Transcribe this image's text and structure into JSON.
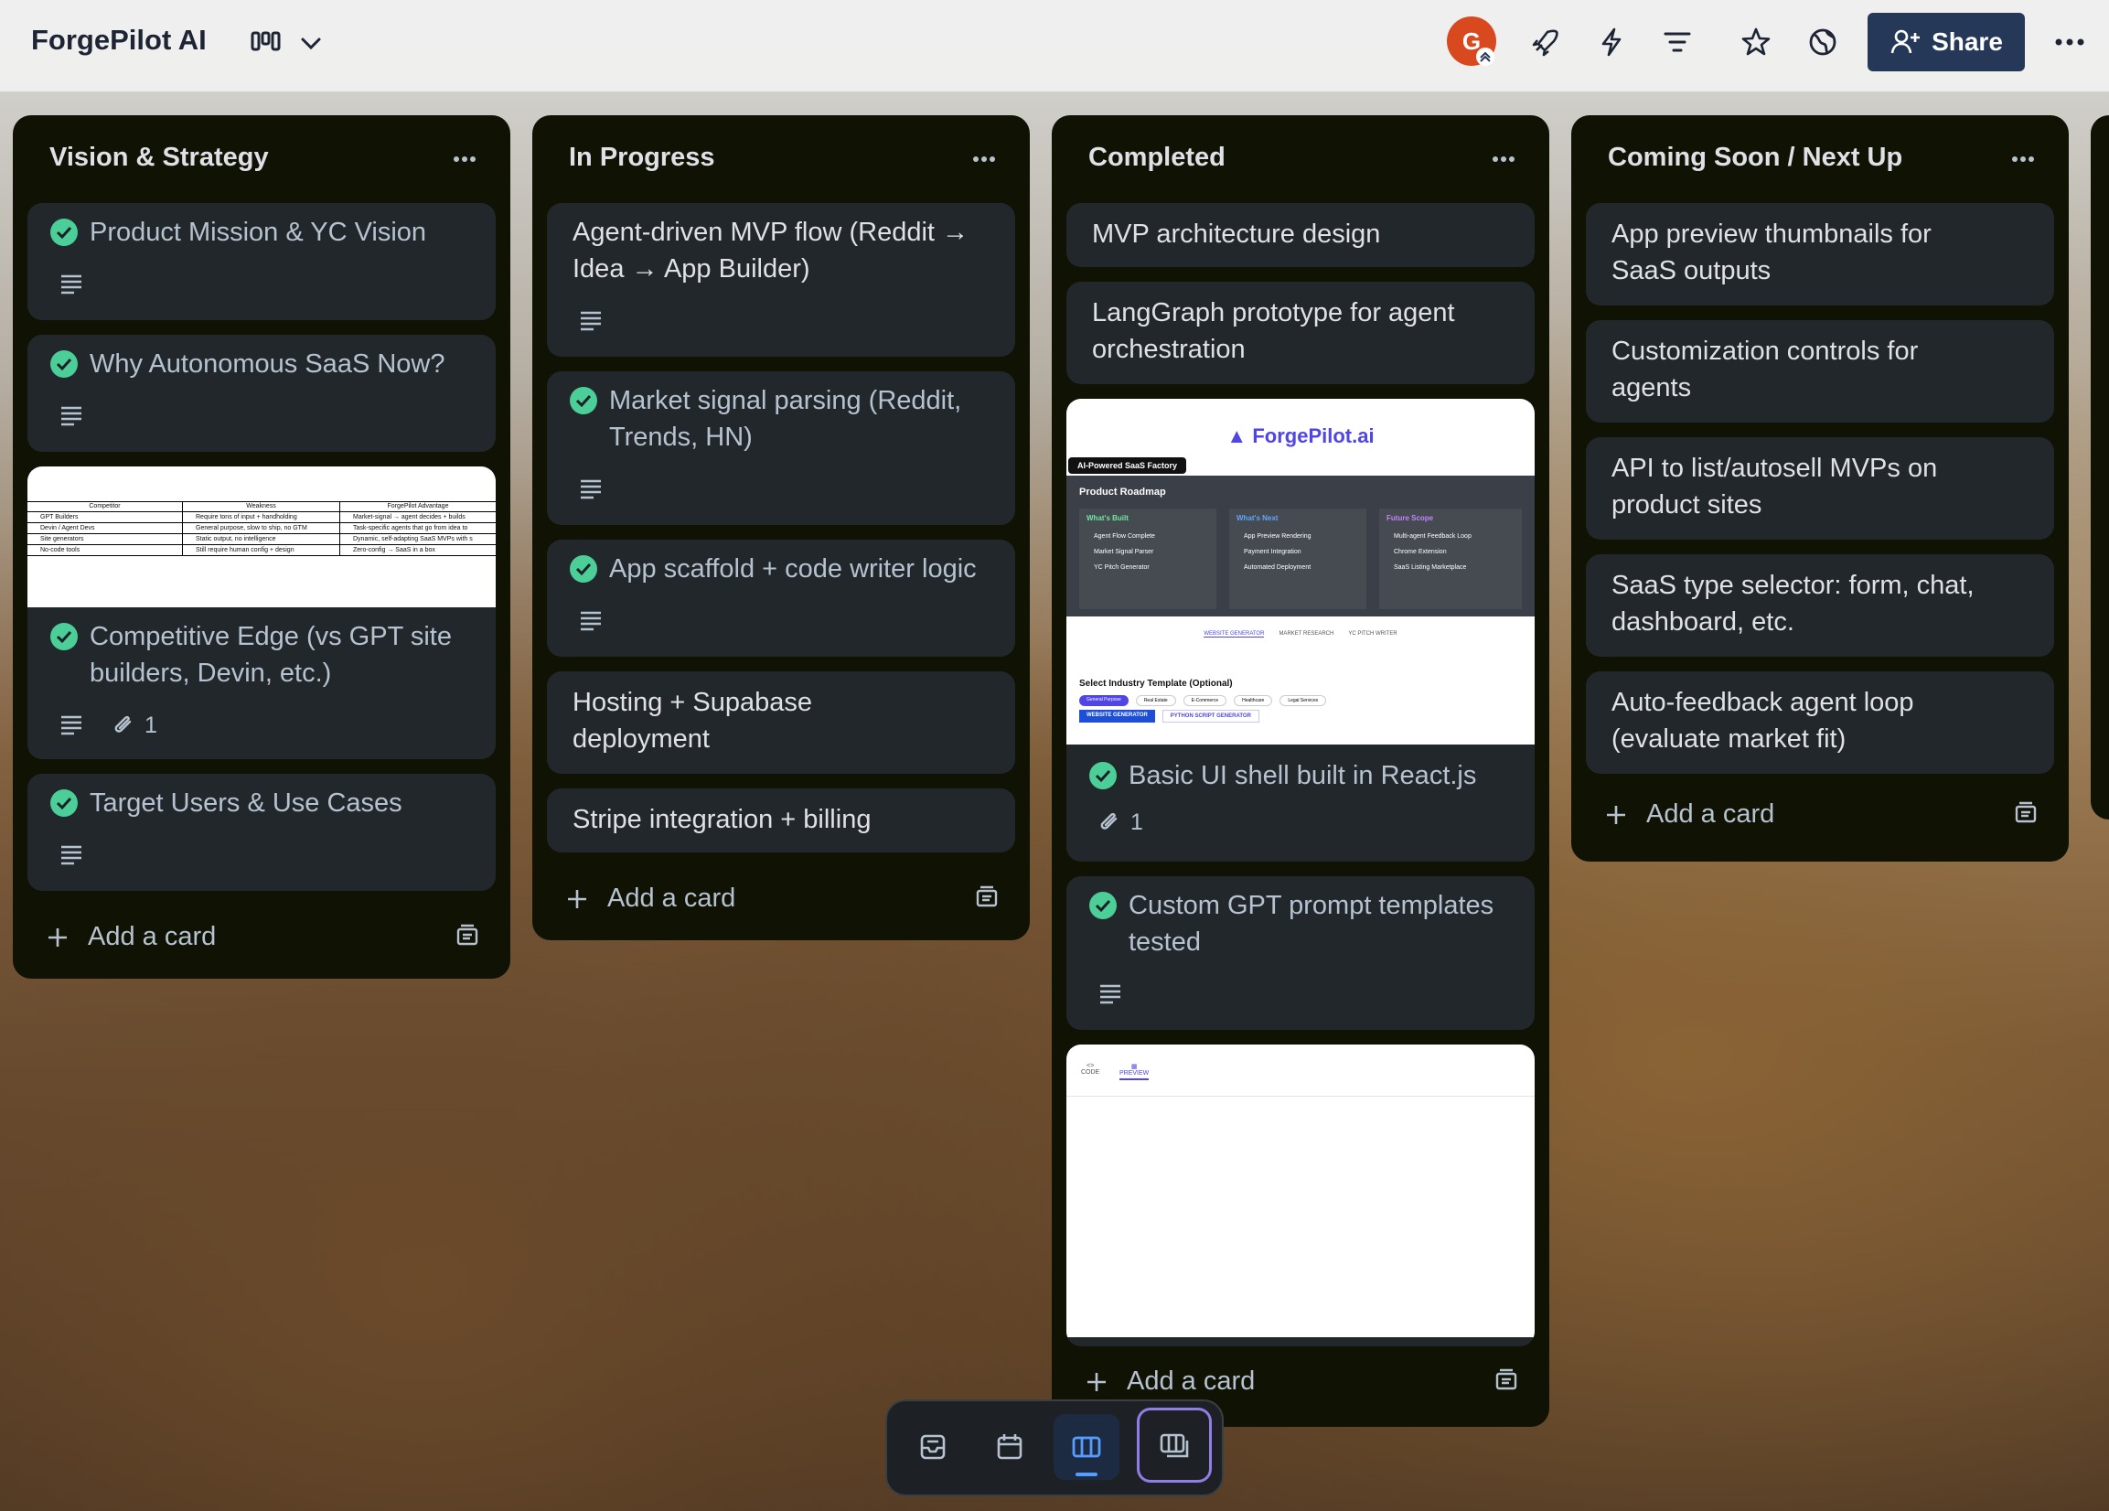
{
  "app": {
    "board_name": "ForgePilot AI"
  },
  "header": {
    "avatar_initial": "G",
    "share_label": "Share"
  },
  "lists": [
    {
      "title": "Vision & Strategy",
      "cards": [
        {
          "title": "Product Mission & YC Vision",
          "done": true
        },
        {
          "title": "Why Autonomous SaaS Now?",
          "done": true
        },
        {
          "title": "Competitive Edge (vs GPT site builders, Devin, etc.)",
          "done": true,
          "attachments": "1",
          "cover_table": {
            "headers": [
              "Competitor",
              "Weakness",
              "ForgePilot Advantage"
            ],
            "rows": [
              [
                "GPT Builders",
                "Require tons of input + handholding",
                "Market-signal → agent decides + builds"
              ],
              [
                "Devin / Agent Devs",
                "General purpose, slow to ship, no GTM",
                "Task-specific agents that go from idea to"
              ],
              [
                "Site generators",
                "Static output, no intelligence",
                "Dynamic, self-adapting SaaS MVPs with s"
              ],
              [
                "No-code tools",
                "Still require human config + design",
                "Zero-config → SaaS in a box"
              ]
            ]
          }
        },
        {
          "title": "Target Users & Use Cases",
          "done": true
        }
      ],
      "add_label": "Add a card"
    },
    {
      "title": "In Progress",
      "cards": [
        {
          "title": "Agent-driven MVP flow (Reddit → Idea → App Builder)",
          "done": false
        },
        {
          "title": "Market signal parsing (Reddit, Trends, HN)",
          "done": true
        },
        {
          "title": "App scaffold + code writer logic",
          "done": true
        },
        {
          "title": "Hosting + Supabase deployment",
          "done": false
        },
        {
          "title": "Stripe integration + billing",
          "done": false
        }
      ],
      "add_label": "Add a card"
    },
    {
      "title": "Completed",
      "cards": [
        {
          "title": "MVP architecture design",
          "done": false
        },
        {
          "title": "LangGraph prototype for agent orchestration",
          "done": false
        },
        {
          "title": "Basic UI shell built in React.js",
          "done": true,
          "attachments": "1",
          "cover_app": {
            "logo": "ForgePilot.ai",
            "tagline": "AI-Powered SaaS Factory",
            "roadmap_title": "Product Roadmap",
            "columns": [
              {
                "head": "What's Built",
                "items": [
                  "Agent Flow Complete",
                  "Market Signal Parser",
                  "YC Pitch Generator"
                ]
              },
              {
                "head": "What's Next",
                "items": [
                  "App Preview Rendering",
                  "Payment Integration",
                  "Automated Deployment"
                ]
              },
              {
                "head": "Future Scope",
                "items": [
                  "Multi-agent Feedback Loop",
                  "Chrome Extension",
                  "SaaS Listing Marketplace"
                ]
              }
            ],
            "tabs": [
              "WEBSITE GENERATOR",
              "MARKET RESEARCH",
              "YC PITCH WRITER"
            ],
            "template_label": "Select Industry Template (Optional)",
            "chips": [
              "General Purpose",
              "Real Estate",
              "E-Commerce",
              "Healthcare",
              "Legal Services"
            ],
            "mode_buttons": [
              "WEBSITE GENERATOR",
              "PYTHON SCRIPT GENERATOR"
            ]
          }
        },
        {
          "title": "Custom GPT prompt templates tested",
          "done": true
        },
        {
          "title": "",
          "done": false,
          "cover_preview": {
            "tabs": [
              "CODE",
              "PREVIEW"
            ]
          }
        }
      ],
      "add_label": "Add a card"
    },
    {
      "title": "Coming Soon / Next Up",
      "cards": [
        {
          "title": "App preview thumbnails for SaaS outputs"
        },
        {
          "title": "Customization controls for agents"
        },
        {
          "title": "API to list/autosell MVPs on product sites"
        },
        {
          "title": "SaaS type selector: form, chat, dashboard, etc."
        },
        {
          "title": "Auto-feedback agent loop (evaluate market fit)"
        }
      ],
      "add_label": "Add a card"
    }
  ],
  "bottom_bar": {
    "active": "board-view",
    "items": [
      "inbox",
      "planner",
      "board",
      "switch-boards"
    ]
  },
  "colors": {
    "list_bg": "#101204",
    "card_bg": "#22272b",
    "check_green": "#4bce97",
    "share_bg": "#253858"
  }
}
